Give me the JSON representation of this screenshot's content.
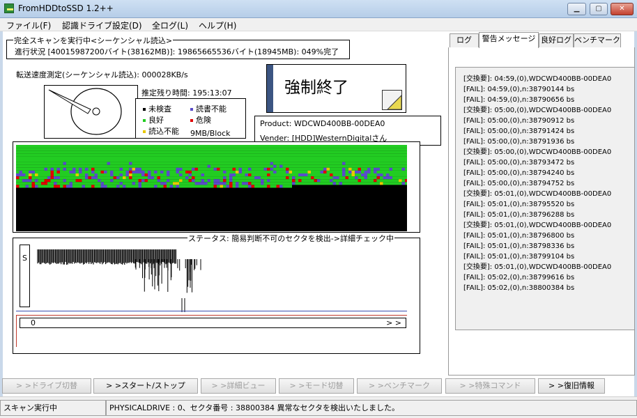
{
  "window": {
    "title": "FromHDDtoSSD   1.2++"
  },
  "menu": [
    "ファイル(F)",
    "認識ドライブ設定(D)",
    "全ログ(L)",
    "ヘルプ(H)"
  ],
  "scan": {
    "group_title": "完全スキャンを実行中<シーケンシャル読込>",
    "progress": "進行状況 [40015987200バイト(38162MB)]: 19865665536バイト(18945MB): 049%完了",
    "percent": 49,
    "speed": "転送速度測定(シーケンシャル読込): 000028KB/s",
    "remaining": "推定残り時間: 195:13:07"
  },
  "legend": {
    "items": [
      {
        "label": "未検査",
        "color": "#000000"
      },
      {
        "label": "読書不能",
        "color": "#5a4cc9"
      },
      {
        "label": "良好",
        "color": "#22cc22"
      },
      {
        "label": "危険",
        "color": "#e00000"
      },
      {
        "label": "読込不能",
        "color": "#e8c800"
      }
    ],
    "block": "9MB/Block"
  },
  "force_stop": {
    "label": "強制終了"
  },
  "drive": {
    "product": "Product: WDCWD400BB-00DEA0",
    "vendor": "Vender: [HDD]WesternDigitalさん"
  },
  "status": {
    "group_title": "ステータス: 簡易判断不可のセクタを検出->詳細チェック中",
    "s_label": "S",
    "bar_start": "0",
    "bar_end": "> >"
  },
  "tabs": [
    "ログ",
    "警告メッセージ",
    "良好ログ",
    "ベンチマーク"
  ],
  "active_tab": 1,
  "log": [
    "[交換要]: 04:59,(0),WDCWD400BB-00DEA0",
    "[FAIL]: 04:59,(0),n:38790144 bs",
    "[FAIL]: 04:59,(0),n:38790656 bs",
    "[交換要]: 05:00,(0),WDCWD400BB-00DEA0",
    "[FAIL]: 05:00,(0),n:38790912 bs",
    "[FAIL]: 05:00,(0),n:38791424 bs",
    "[FAIL]: 05:00,(0),n:38791936 bs",
    "[交換要]: 05:00,(0),WDCWD400BB-00DEA0",
    "[FAIL]: 05:00,(0),n:38793472 bs",
    "[FAIL]: 05:00,(0),n:38794240 bs",
    "[FAIL]: 05:00,(0),n:38794752 bs",
    "[交換要]: 05:01,(0),WDCWD400BB-00DEA0",
    "[FAIL]: 05:01,(0),n:38795520 bs",
    "[FAIL]: 05:01,(0),n:38796288 bs",
    "[交換要]: 05:01,(0),WDCWD400BB-00DEA0",
    "[FAIL]: 05:01,(0),n:38796800 bs",
    "[FAIL]: 05:01,(0),n:38798336 bs",
    "[FAIL]: 05:01,(0),n:38799104 bs",
    "[交換要]: 05:01,(0),WDCWD400BB-00DEA0",
    "[FAIL]: 05:02,(0),n:38799616 bs",
    "[FAIL]: 05:02,(0),n:38800384 bs"
  ],
  "buttons": [
    {
      "label": "> >ドライブ切替",
      "enabled": false
    },
    {
      "label": "> >スタート/ストップ",
      "enabled": true
    },
    {
      "label": "> >詳細ビュー",
      "enabled": false
    },
    {
      "label": "> >モード切替",
      "enabled": false
    },
    {
      "label": "> >ベンチマーク",
      "enabled": false
    },
    {
      "label": "> >特殊コマンド",
      "enabled": false
    },
    {
      "label": "> >復旧情報",
      "enabled": true
    }
  ],
  "statusbar": {
    "left": "スキャン実行中",
    "right": "PHYSICALDRIVE : 0、セクタ番号 : 38800384 異常なセクタを検出いたしました。"
  }
}
